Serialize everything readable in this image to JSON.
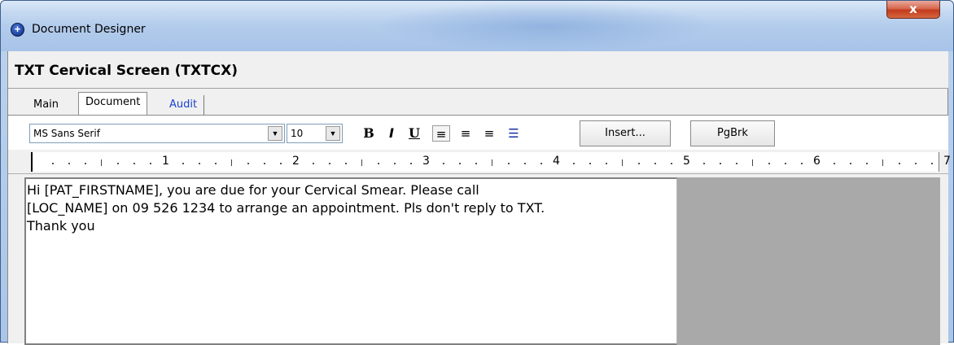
{
  "window": {
    "title": "Document Designer",
    "close_label": "x"
  },
  "document": {
    "heading": "TXT Cervical Screen (TXTCX)"
  },
  "tabs": [
    {
      "label": "Main"
    },
    {
      "label": "Document"
    },
    {
      "label": "Audit"
    }
  ],
  "toolbar": {
    "font_name": "MS Sans Serif",
    "font_size": "10",
    "bold_icon": "B",
    "italic_icon": "I",
    "underline_icon": "U",
    "align_left_icon": "≡",
    "align_center_icon": "≡",
    "align_right_icon": "≡",
    "bullets_icon": "☰",
    "insert_label": "Insert...",
    "pgbrk_label": "PgBrk"
  },
  "ruler": {
    "numbers": [
      "1",
      "2",
      "3",
      "4",
      "5",
      "6",
      "7"
    ]
  },
  "editor": {
    "content": "Hi [PAT_FIRSTNAME], you are due for your Cervical Smear. Please call\n[LOC_NAME] on 09 526 1234 to arrange an appointment. Pls don't reply to TXT.\nThank you"
  },
  "colors": {
    "titlebar": "#b3ccec",
    "close_button": "#c23b1c",
    "audit_tab": "#1a3fd0",
    "preview_panel": "#a9a9a9"
  }
}
